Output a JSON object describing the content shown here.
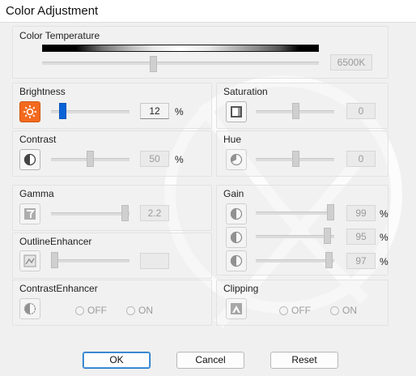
{
  "window": {
    "title": "Color Adjustment"
  },
  "color_temperature": {
    "label": "Color Temperature",
    "value": "6500K",
    "slider_position": 0.44
  },
  "brightness": {
    "label": "Brightness",
    "value": "12",
    "unit": "%",
    "slider_position": 0.14
  },
  "saturation": {
    "label": "Saturation",
    "value": "0",
    "slider_position": 0.5
  },
  "contrast": {
    "label": "Contrast",
    "value": "50",
    "unit": "%",
    "slider_position": 0.5
  },
  "hue": {
    "label": "Hue",
    "value": "0",
    "slider_position": 0.5
  },
  "gamma": {
    "label": "Gamma",
    "value": "2.2",
    "slider_position": 0.95
  },
  "gain": {
    "label": "Gain",
    "channels": [
      {
        "value": "99",
        "unit": "%",
        "slider_position": 0.99
      },
      {
        "value": "95",
        "unit": "%",
        "slider_position": 0.95
      },
      {
        "value": "97",
        "unit": "%",
        "slider_position": 0.97
      }
    ]
  },
  "outline_enhancer": {
    "label": "OutlineEnhancer",
    "value": "",
    "slider_position": 0.0
  },
  "contrast_enhancer": {
    "label": "ContrastEnhancer",
    "off_label": "OFF",
    "on_label": "ON"
  },
  "clipping": {
    "label": "Clipping",
    "off_label": "OFF",
    "on_label": "ON"
  },
  "buttons": {
    "ok": "OK",
    "cancel": "Cancel",
    "reset": "Reset"
  }
}
